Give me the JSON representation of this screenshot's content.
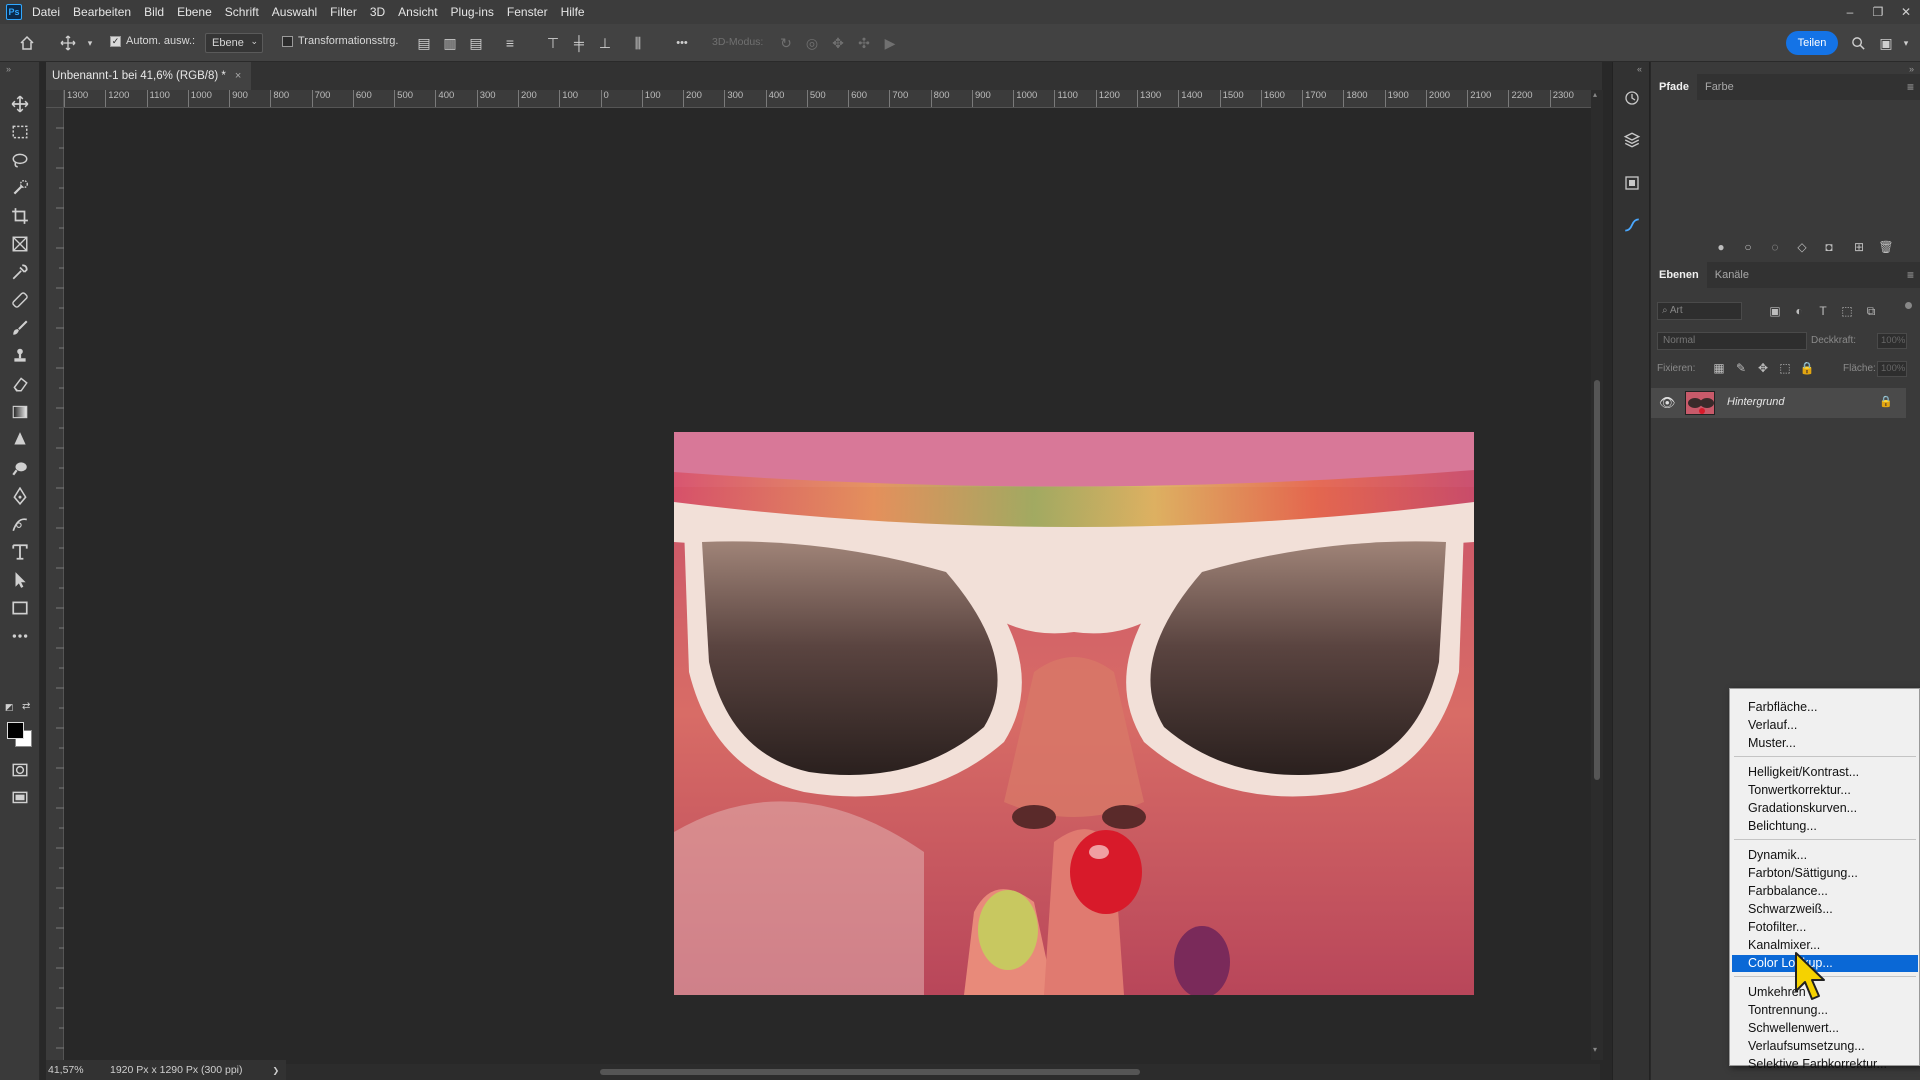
{
  "app": {
    "logo": "Ps",
    "menu": [
      "Datei",
      "Bearbeiten",
      "Bild",
      "Ebene",
      "Schrift",
      "Auswahl",
      "Filter",
      "3D",
      "Ansicht",
      "Plug-ins",
      "Fenster",
      "Hilfe"
    ]
  },
  "window_controls": {
    "minimize": "–",
    "restore": "❐",
    "close": "✕"
  },
  "options": {
    "auto_select_label": "Autom. ausw.:",
    "auto_select_checked": true,
    "layer_select_value": "Ebene",
    "transform_label": "Transformationsstrg.",
    "transform_checked": false,
    "more": "•••",
    "mode_3d_label": "3D-Modus:",
    "share_label": "Teilen"
  },
  "document": {
    "tab_title": "Unbenannt-1 bei 41,6% (RGB/8) *",
    "close": "×"
  },
  "ruler": {
    "top_labels": [
      "1300",
      "1200",
      "1100",
      "1000",
      "900",
      "800",
      "700",
      "600",
      "500",
      "400",
      "300",
      "200",
      "100",
      "0",
      "100",
      "200",
      "300",
      "400",
      "500",
      "600",
      "700",
      "800",
      "900",
      "1000",
      "1100",
      "1200",
      "1300",
      "1400",
      "1500",
      "1600",
      "1700",
      "1800",
      "1900",
      "2000",
      "2100",
      "2200",
      "2300"
    ]
  },
  "status": {
    "zoom": "41,57%",
    "info": "1920 Px x 1290 Px (300 ppi)",
    "arrow": "❯"
  },
  "panels": {
    "top_tabs": [
      "Pfade",
      "Farbe"
    ],
    "layer_tabs": [
      "Ebenen",
      "Kanäle"
    ],
    "search_placeholder": "Art",
    "blend_mode": "Normal",
    "opacity_label": "Deckkraft:",
    "opacity_value": "100%",
    "lock_label": "Fixieren:",
    "fill_label": "Fläche:",
    "fill_value": "100%",
    "layers": [
      {
        "name": "Hintergrund",
        "visible": true,
        "locked": true
      }
    ]
  },
  "context_menu": {
    "groups": [
      [
        "Farbfläche...",
        "Verlauf...",
        "Muster..."
      ],
      [
        "Helligkeit/Kontrast...",
        "Tonwertkorrektur...",
        "Gradationskurven...",
        "Belichtung..."
      ],
      [
        "Dynamik...",
        "Farbton/Sättigung...",
        "Farbbalance...",
        "Schwarzweiß...",
        "Fotofilter...",
        "Kanalmixer...",
        "Color Lookup..."
      ],
      [
        "Umkehren",
        "Tontrennung...",
        "Schwellenwert...",
        "Verlaufsumsetzung...",
        "Selektive Farbkorrektur..."
      ]
    ],
    "highlighted": "Color Lookup..."
  },
  "colors": {
    "accent": "#1473e6",
    "menu_highlight": "#0a68d6",
    "foreground": "#000000",
    "background": "#ffffff"
  }
}
